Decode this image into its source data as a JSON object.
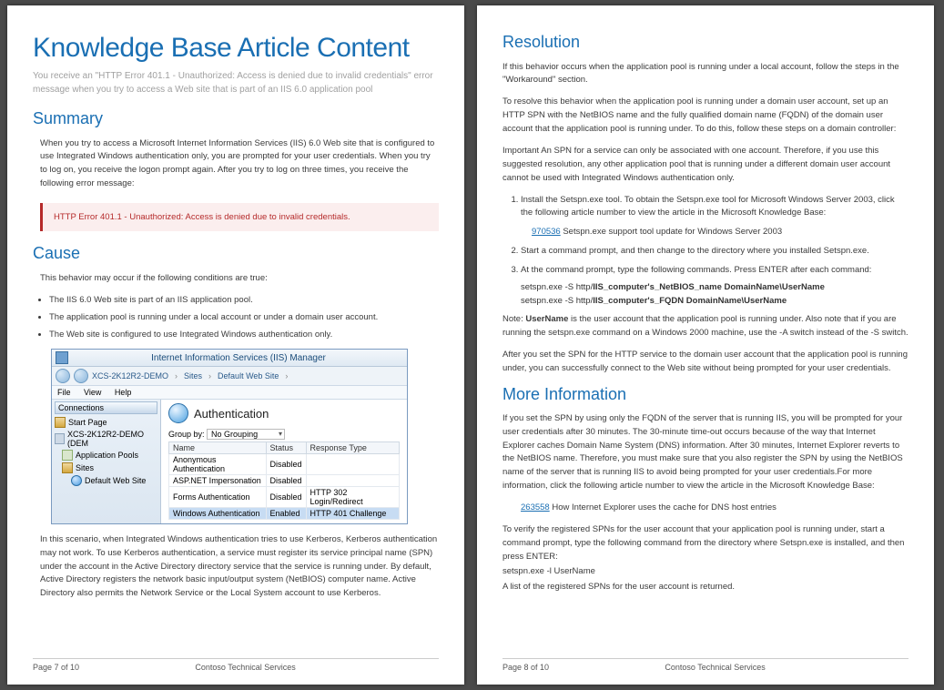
{
  "page_left": {
    "title": "Knowledge Base Article Content",
    "subtitle": "You receive an \"HTTP Error 401.1 - Unauthorized: Access is denied due to invalid credentials\" error message when you try to access a Web site that is part of an IIS 6.0 application pool",
    "summary_h": "Summary",
    "summary_p": "When you try to access a Microsoft Internet Information Services (IIS) 6.0 Web site that is configured to use Integrated Windows authentication only, you are prompted for your user credentials. When you try to log on, you receive the logon prompt again. After you try to log on three times, you receive the following error message:",
    "error_text": "HTTP Error 401.1 - Unauthorized: Access is denied due to invalid credentials.",
    "cause_h": "Cause",
    "cause_intro": "This behavior may occur if the following conditions are true:",
    "cause_bullets": [
      "The IIS 6.0 Web site is part of an IIS application pool.",
      "The application pool is running under a local account or under a domain user account.",
      "The Web site is configured to use Integrated Windows authentication only."
    ],
    "iis": {
      "title": "Internet Information Services (IIS) Manager",
      "breadcrumb": [
        "XCS-2K12R2-DEMO",
        "Sites",
        "Default Web Site"
      ],
      "menus": [
        "File",
        "View",
        "Help"
      ],
      "connections_h": "Connections",
      "tree": {
        "start": "Start Page",
        "server": "XCS-2K12R2-DEMO (DEM",
        "pools": "Application Pools",
        "sites": "Sites",
        "site1": "Default Web Site"
      },
      "main_h": "Authentication",
      "groupby_label": "Group by:",
      "groupby_value": "No Grouping",
      "cols": [
        "Name",
        "Status",
        "Response Type"
      ],
      "rows": [
        [
          "Anonymous Authentication",
          "Disabled",
          ""
        ],
        [
          "ASP.NET Impersonation",
          "Disabled",
          ""
        ],
        [
          "Forms Authentication",
          "Disabled",
          "HTTP 302 Login/Redirect"
        ],
        [
          "Windows Authentication",
          "Enabled",
          "HTTP 401 Challenge"
        ]
      ]
    },
    "scenario_p": "In this scenario, when Integrated Windows authentication tries to use Kerberos, Kerberos authentication may not work. To use Kerberos authentication, a service must register its service principal name (SPN) under the account in the Active Directory directory service that the service is running under. By default, Active Directory registers the network basic input/output system (NetBIOS) computer name. Active Directory also permits the Network Service or the Local System account to use Kerberos.",
    "footer_page": "Page 7 of 10",
    "footer_co": "Contoso Technical Services"
  },
  "page_right": {
    "res_h": "Resolution",
    "res_p1": "If this behavior occurs when the application pool is running under a local account, follow the steps in the \"Workaround\" section.",
    "res_p2": "To resolve this behavior when the application pool is running under a domain user account, set up an HTTP SPN with the NetBIOS name and the fully qualified domain name (FQDN) of the domain user account that the application pool is running under. To do this, follow these steps on a domain controller:",
    "res_important": "Important An SPN for a service can only be associated with one account. Therefore, if you use this suggested resolution, any other application pool that is running under a different domain user account cannot be used with Integrated Windows authentication only.",
    "step1": "Install the Setspn.exe tool. To obtain the Setspn.exe tool for Microsoft Windows Server 2003, click the following article number to view the article in the Microsoft Knowledge Base:",
    "link1_num": "970536",
    "link1_txt": " Setspn.exe support tool update for Windows Server 2003",
    "step2": "Start a command prompt, and then change to the directory where you installed Setspn.exe.",
    "step3": "At the command prompt, type the following commands. Press ENTER after each command:",
    "cmd1_pre": "setspn.exe -S http/",
    "cmd1_bold": "IIS_computer's_NetBIOS_name DomainName\\UserName",
    "cmd2_pre": "setspn.exe -S http/",
    "cmd2_bold": "IIS_computer's_FQDN DomainName\\UserName",
    "note_pre": "Note: ",
    "note_bold": "UserName",
    "note_post": " is the user account that the application pool is running under. Also note that if you are running the setspn.exe command on a Windows 2000 machine, use the -A switch instead of the -S switch.",
    "after_p": "After you set the SPN for the HTTP service to the domain user account that the application pool is running under, you can successfully connect to the Web site without being prompted for your user credentials.",
    "more_h": "More Information",
    "more_p": "If you set the SPN by using only the FQDN of the server that is running IIS, you will be prompted for your user credentials after 30 minutes. The 30-minute time-out occurs because of the way that Internet Explorer caches Domain Name System (DNS) information. After 30 minutes, Internet Explorer reverts to the NetBIOS name. Therefore, you must make sure that you also register the SPN by using the NetBIOS name of the server that is running IIS to avoid being prompted for your user credentials.For more information, click the following article number to view the article in the Microsoft Knowledge Base:",
    "link2_num": "263558",
    "link2_txt": " How Internet Explorer uses the cache for DNS host entries",
    "verify_p1": "To verify the registered SPNs for the user account that your application pool is running under, start a command prompt, type the following command from the directory where Setspn.exe is installed, and then press ENTER:",
    "verify_cmd": "setspn.exe -l UserName",
    "verify_p2": "A list of the registered SPNs for the user account is returned.",
    "footer_page": "Page 8 of 10",
    "footer_co": "Contoso Technical Services"
  }
}
